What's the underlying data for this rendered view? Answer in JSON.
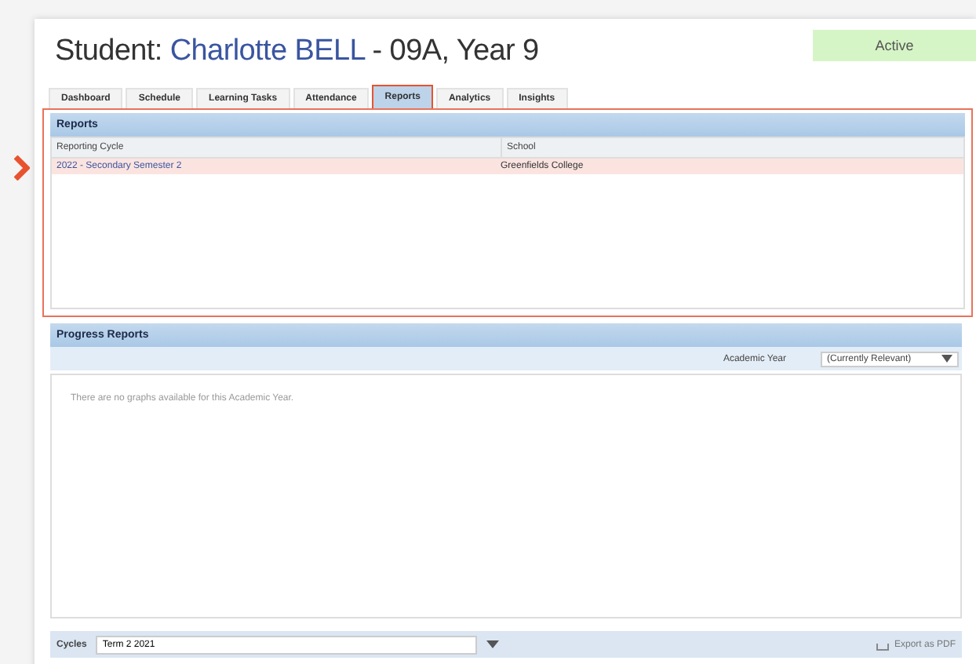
{
  "header": {
    "label": "Student:",
    "name": "Charlotte BELL",
    "suffix": "- 09A, Year 9",
    "status": "Active"
  },
  "tabs": [
    {
      "label": "Dashboard",
      "selected": false
    },
    {
      "label": "Schedule",
      "selected": false
    },
    {
      "label": "Learning Tasks",
      "selected": false
    },
    {
      "label": "Attendance",
      "selected": false
    },
    {
      "label": "Reports",
      "selected": true
    },
    {
      "label": "Analytics",
      "selected": false
    },
    {
      "label": "Insights",
      "selected": false
    }
  ],
  "reports": {
    "title": "Reports",
    "columns": [
      "Reporting Cycle",
      "School"
    ],
    "rows": [
      {
        "cycle": "2022 - Secondary Semester 2",
        "school": "Greenfields College",
        "selected": true
      }
    ]
  },
  "progress_reports": {
    "title": "Progress Reports",
    "year_label": "Academic Year",
    "year_value": "(Currently Relevant)",
    "message": "There are no graphs available for this Academic Year."
  },
  "footer": {
    "cycles_label": "Cycles",
    "cycles_value": "Term 2 2021",
    "export": "Export as PDF"
  }
}
